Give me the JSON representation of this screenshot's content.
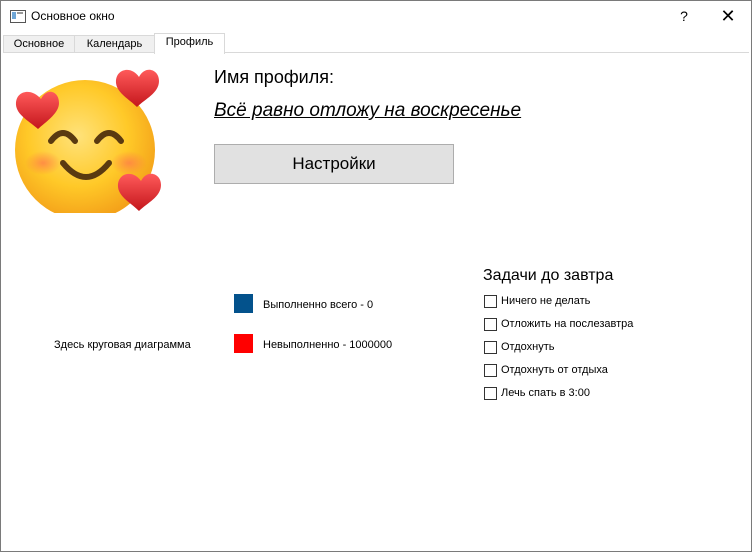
{
  "window": {
    "title": "Основное окно",
    "help_label": "?",
    "close_label": "✕"
  },
  "tabs": [
    {
      "label": "Основное",
      "active": false
    },
    {
      "label": "Календарь",
      "active": false
    },
    {
      "label": "Профиль",
      "active": true
    }
  ],
  "profile": {
    "label": "Имя профиля:",
    "name": "Всё равно отложу на воскресенье",
    "settings_button": "Настройки",
    "avatar_icon": "smiling-face-with-hearts-icon"
  },
  "stats": {
    "pie_placeholder": "Здесь круговая диаграмма",
    "legend": [
      {
        "label": "Выполненно всего - 0",
        "color": "#03528c"
      },
      {
        "label": "Невыполненно - 1000000",
        "color": "#ff0000"
      }
    ]
  },
  "tasks": {
    "title": "Задачи до завтра",
    "items": [
      {
        "label": "Ничего не делать",
        "checked": false
      },
      {
        "label": "Отложить на послезавтра",
        "checked": false
      },
      {
        "label": "Отдохнуть",
        "checked": false
      },
      {
        "label": "Отдохнуть от отдыха",
        "checked": false
      },
      {
        "label": "Лечь спать в 3:00",
        "checked": false
      }
    ]
  }
}
